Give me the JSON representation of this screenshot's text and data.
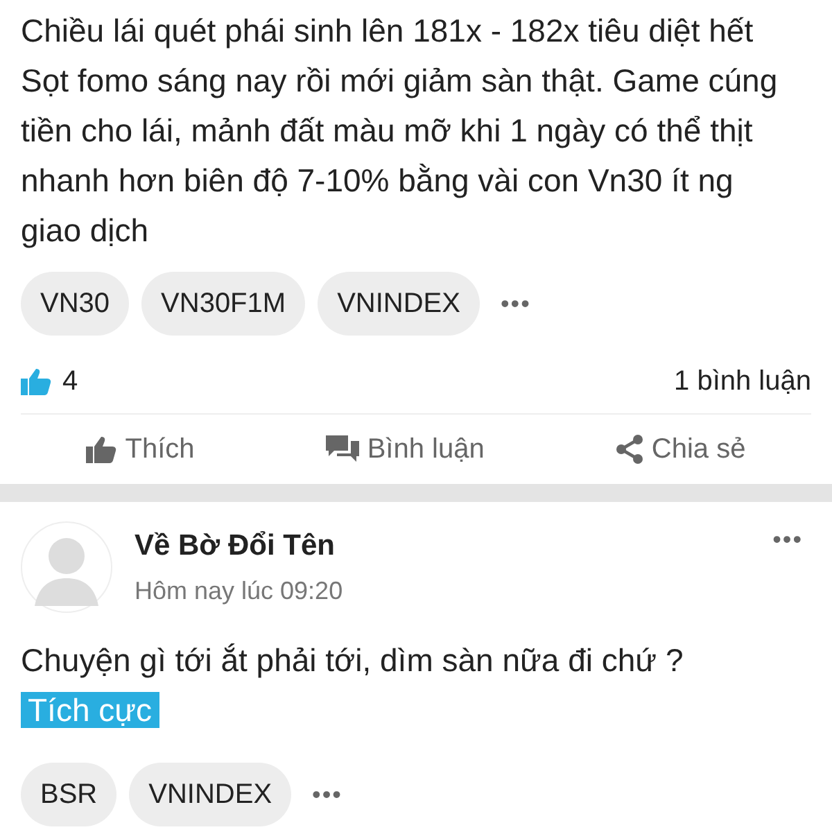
{
  "posts": [
    {
      "body": "Chiều lái quét phái sinh lên 181x - 182x tiêu diệt hết Sọt fomo sáng nay rồi mới giảm sàn thật. Game cúng tiền cho lái, mảnh đất màu mỡ khi 1 ngày có thể thịt nhanh hơn biên độ 7-10% bằng vài con Vn30 ít ng giao dịch",
      "tags": [
        "VN30",
        "VN30F1M",
        "VNINDEX"
      ],
      "more_tags": "•••",
      "likes": "4",
      "comments": "1 bình luận",
      "actions": [
        {
          "kind": "like",
          "label": "Thích"
        },
        {
          "kind": "comment",
          "label": "Bình luận"
        },
        {
          "kind": "share",
          "label": "Chia sẻ"
        }
      ]
    },
    {
      "author": "Về Bờ Đổi Tên",
      "time": "Hôm nay lúc 09:20",
      "menu": "•••",
      "body": "Chuyện gì tới ắt phải tới, dìm sàn nữa đi chứ ?",
      "sentiment": {
        "kind": "positive",
        "label": "Tích cực"
      },
      "tags": [
        "BSR",
        "VNINDEX"
      ],
      "more_tags": "•••"
    }
  ]
}
